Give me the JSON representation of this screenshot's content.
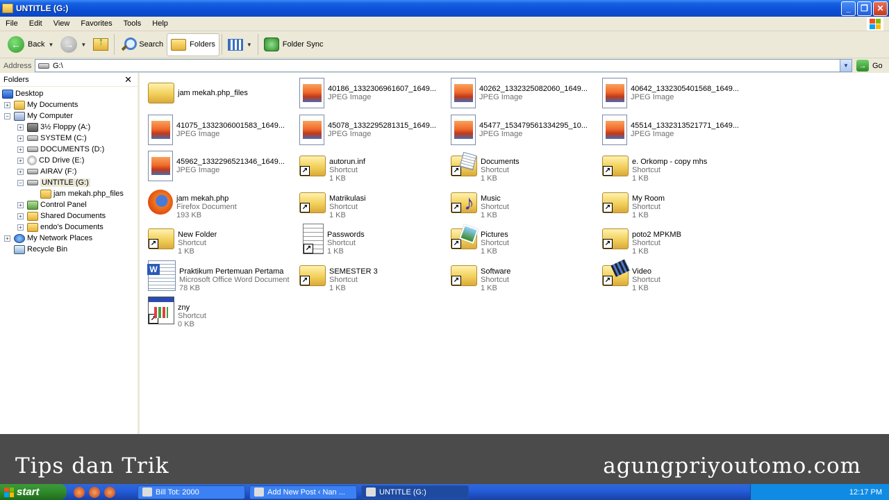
{
  "window": {
    "title": "UNTITLE (G:)"
  },
  "menu": [
    "File",
    "Edit",
    "View",
    "Favorites",
    "Tools",
    "Help"
  ],
  "toolbar": {
    "back": "Back",
    "search": "Search",
    "folders": "Folders",
    "folder_sync": "Folder Sync"
  },
  "address": {
    "label": "Address",
    "value": "G:\\",
    "go": "Go"
  },
  "folders_pane": {
    "title": "Folders",
    "tree": [
      {
        "label": "Desktop",
        "icon": "desktop-icon",
        "indent": 0,
        "expander": ""
      },
      {
        "label": "My Documents",
        "icon": "my-documents-icon",
        "indent": 1,
        "expander": "+"
      },
      {
        "label": "My Computer",
        "icon": "computer-icon",
        "indent": 1,
        "expander": "−"
      },
      {
        "label": "3½ Floppy (A:)",
        "icon": "floppy-icon",
        "indent": 2,
        "expander": "+"
      },
      {
        "label": "SYSTEM (C:)",
        "icon": "drive-icon",
        "indent": 2,
        "expander": "+"
      },
      {
        "label": "DOCUMENTS (D:)",
        "icon": "drive-icon",
        "indent": 2,
        "expander": "+"
      },
      {
        "label": "CD Drive (E:)",
        "icon": "cd-icon",
        "indent": 2,
        "expander": "+"
      },
      {
        "label": "AIRAV (F:)",
        "icon": "drive-icon",
        "indent": 2,
        "expander": "+"
      },
      {
        "label": "UNTITLE (G:)",
        "icon": "drive-icon",
        "indent": 2,
        "expander": "−",
        "selected": true
      },
      {
        "label": "jam mekah.php_files",
        "icon": "folder-icon",
        "indent": 3,
        "expander": ""
      },
      {
        "label": "Control Panel",
        "icon": "control-panel-icon",
        "indent": 2,
        "expander": "+"
      },
      {
        "label": "Shared Documents",
        "icon": "folder-icon",
        "indent": 2,
        "expander": "+"
      },
      {
        "label": "endo's Documents",
        "icon": "folder-icon",
        "indent": 2,
        "expander": "+"
      },
      {
        "label": "My Network Places",
        "icon": "network-icon",
        "indent": 1,
        "expander": "+"
      },
      {
        "label": "Recycle Bin",
        "icon": "recycle-bin-icon",
        "indent": 1,
        "expander": ""
      }
    ]
  },
  "files": [
    {
      "name": "jam mekah.php_files",
      "type": "",
      "size": "",
      "icon": "folder",
      "shortcut": false
    },
    {
      "name": "40186_1332306961607_1649...",
      "type": "JPEG Image",
      "size": "",
      "icon": "jpeg",
      "shortcut": false
    },
    {
      "name": "40262_1332325082060_1649...",
      "type": "JPEG Image",
      "size": "",
      "icon": "jpeg",
      "shortcut": false
    },
    {
      "name": "40642_1332305401568_1649...",
      "type": "JPEG Image",
      "size": "",
      "icon": "jpeg",
      "shortcut": false
    },
    {
      "name": "41075_1332306001583_1649...",
      "type": "JPEG Image",
      "size": "",
      "icon": "jpeg",
      "shortcut": false
    },
    {
      "name": "45078_1332295281315_1649...",
      "type": "JPEG Image",
      "size": "",
      "icon": "jpeg",
      "shortcut": false
    },
    {
      "name": "45477_153479561334295_10...",
      "type": "JPEG Image",
      "size": "",
      "icon": "jpeg",
      "shortcut": false
    },
    {
      "name": "45514_1332313521771_1649...",
      "type": "JPEG Image",
      "size": "",
      "icon": "jpeg",
      "shortcut": false
    },
    {
      "name": "45962_1332296521346_1649...",
      "type": "JPEG Image",
      "size": "",
      "icon": "jpeg",
      "shortcut": false
    },
    {
      "name": "autorun.inf",
      "type": "Shortcut",
      "size": "1 KB",
      "icon": "folder",
      "shortcut": true
    },
    {
      "name": "Documents",
      "type": "Shortcut",
      "size": "1 KB",
      "icon": "docs",
      "shortcut": true
    },
    {
      "name": "e. Orkomp - copy mhs",
      "type": "Shortcut",
      "size": "1 KB",
      "icon": "folder",
      "shortcut": true
    },
    {
      "name": "jam mekah.php",
      "type": "Firefox Document",
      "size": "193 KB",
      "icon": "firefox",
      "shortcut": false
    },
    {
      "name": "Matrikulasi",
      "type": "Shortcut",
      "size": "1 KB",
      "icon": "folder",
      "shortcut": true
    },
    {
      "name": "Music",
      "type": "Shortcut",
      "size": "1 KB",
      "icon": "music",
      "shortcut": true
    },
    {
      "name": "My Room",
      "type": "Shortcut",
      "size": "1 KB",
      "icon": "folder",
      "shortcut": true
    },
    {
      "name": "New Folder",
      "type": "Shortcut",
      "size": "1 KB",
      "icon": "folder",
      "shortcut": true
    },
    {
      "name": "Passwords",
      "type": "Shortcut",
      "size": "1 KB",
      "icon": "notepad",
      "shortcut": true
    },
    {
      "name": "Pictures",
      "type": "Shortcut",
      "size": "1 KB",
      "icon": "pictures",
      "shortcut": true
    },
    {
      "name": "poto2 MPKMB",
      "type": "Shortcut",
      "size": "1 KB",
      "icon": "folder",
      "shortcut": true
    },
    {
      "name": "Praktikum Pertemuan Pertama",
      "type": "Microsoft Office Word Document",
      "size": "78 KB",
      "icon": "word",
      "shortcut": false
    },
    {
      "name": "SEMESTER 3",
      "type": "Shortcut",
      "size": "1 KB",
      "icon": "folder",
      "shortcut": true
    },
    {
      "name": "Software",
      "type": "Shortcut",
      "size": "1 KB",
      "icon": "folder",
      "shortcut": true
    },
    {
      "name": "Video",
      "type": "Shortcut",
      "size": "1 KB",
      "icon": "video",
      "shortcut": true
    },
    {
      "name": "zny",
      "type": "Shortcut",
      "size": "0 KB",
      "icon": "app",
      "shortcut": true
    }
  ],
  "banner": {
    "left": "Tips dan Trik",
    "right": "agungpriyoutomo.com"
  },
  "taskbar": {
    "start": "start",
    "tasks": [
      {
        "label": "Bill Tot: 2000",
        "active": false
      },
      {
        "label": "Add New Post ‹ Nan ...",
        "active": false
      },
      {
        "label": "UNTITLE (G:)",
        "active": true
      }
    ],
    "clock": "12:17 PM"
  }
}
